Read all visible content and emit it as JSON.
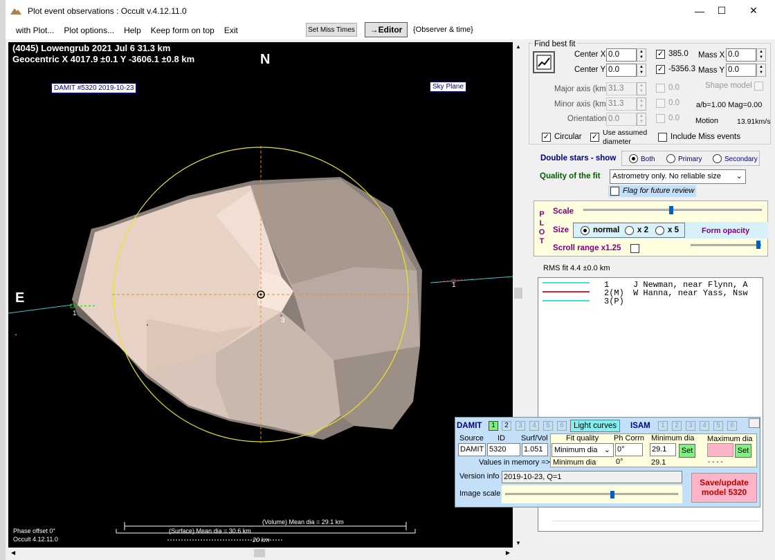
{
  "window": {
    "title": "Plot event observations : Occult v.4.12.11.0",
    "min": "—",
    "max": "☐",
    "close": "✕"
  },
  "menu": {
    "with_plot": "with Plot...",
    "plot_options": "Plot options...",
    "help": "Help",
    "keep_on_top": "Keep form on top",
    "exit": "Exit",
    "set_miss": "Set Miss Times",
    "editor": "→Editor",
    "observer_time": "{Observer & time}"
  },
  "plot": {
    "line1": "(4045) Lowengrub  2021 Jul 6   31.3 km",
    "line2": "Geocentric  X  4017.9 ±0.1  Y -3606.1 ±0.8 km",
    "north": "N",
    "east": "E",
    "damit_label": "DAMIT #5320 2019-10-23",
    "sky_plane": "Sky Plane",
    "chord1_left": "1",
    "chord1_right": "1",
    "chord3": "3",
    "volume_dia": "(Volume) Mean dia = 29.1 km",
    "surface_dia": "(Surface) Mean dia = 30.6 km",
    "scale_20km": "20 km",
    "phase_offset": "Phase offset 0°",
    "version": "Occult 4.12.11.0"
  },
  "bestfit": {
    "title": "Find best fit",
    "center_x_label": "Center X",
    "center_x": "0.0",
    "center_y_label": "Center Y",
    "center_y": "0.0",
    "x_check_value": "385.0",
    "y_check_value": "-5356.3",
    "mass_x_label": "Mass X",
    "mass_x": "0.0",
    "mass_y_label": "Mass Y",
    "mass_y": "0.0",
    "major_label": "Major axis (km)",
    "major": "31.3",
    "major_val": "0.0",
    "minor_label": "Minor axis (km)",
    "minor": "31.3",
    "minor_val": "0.0",
    "orient_label": "Orientation",
    "orient": "0.0",
    "orient_val": "0.0",
    "shape_model": "Shape model",
    "ab_mag": "a/b=1.00  Mag=0.00",
    "motion_label": "Motion",
    "motion": "13.91km/s",
    "circular": "Circular",
    "use_assumed": "Use assumed",
    "diameter": "diameter",
    "include_miss": "Include Miss events",
    "double_stars": "Double stars - show",
    "both": "Both",
    "primary": "Primary",
    "secondary": "Secondary",
    "quality_label": "Quality of the fit",
    "quality_value": "Astrometry only. No reliable size",
    "flag_review": "Flag for future review"
  },
  "plotpanel": {
    "side": [
      "P",
      "L",
      "O",
      "T"
    ],
    "scale": "Scale",
    "size": "Size",
    "normal": "normal",
    "x2": "x 2",
    "x5": "x 5",
    "form_opacity": "Form opacity",
    "scroll_range": "Scroll range x1.25"
  },
  "rms": "RMS fit 4.4 ±0.0 km",
  "observers": [
    {
      "num": "1",
      "name": "J Newman, near Flynn, A",
      "color": "#40e0e0"
    },
    {
      "num": "2(M)",
      "name": "W Hanna, near Yass, Nsw",
      "color": "#e02020"
    },
    {
      "num": "3(P)",
      "name": "",
      "color": "#40e0e0"
    }
  ],
  "damit": {
    "damit_title": "DAMIT",
    "tabs": [
      "1",
      "2",
      "3",
      "4",
      "5",
      "6"
    ],
    "light_curves": "Light curves",
    "isam": "ISAM",
    "source_label": "Source",
    "id_label": "ID",
    "surf_label": "Surf/Vol",
    "fitq_label": "Fit quality",
    "phcorr_label": "Ph Corrn",
    "mindia_label": "Minimum dia",
    "maxdia_label": "Maximum dia",
    "source": "DAMIT",
    "id": "5320",
    "surf": "1.051",
    "fitq_select": "Minimum dia",
    "phcorr": "0°",
    "mindia": "29.1",
    "set": "Set",
    "values_mem": "Values in memory =>",
    "mem_fitq": "Minimum dia",
    "mem_ph": "0°",
    "mem_min": "29.1",
    "mem_max": "- - - -",
    "version_label": "Version info",
    "version": "2019-10-23, Q=1",
    "image_scale": "Image scale",
    "save": "Save/update model 5320"
  },
  "colors": {
    "accent_green": "#80f080",
    "save_pink": "#ffb4c8",
    "panel_blue": "#c4e0f8",
    "circle_yellow": "#ffff40"
  }
}
